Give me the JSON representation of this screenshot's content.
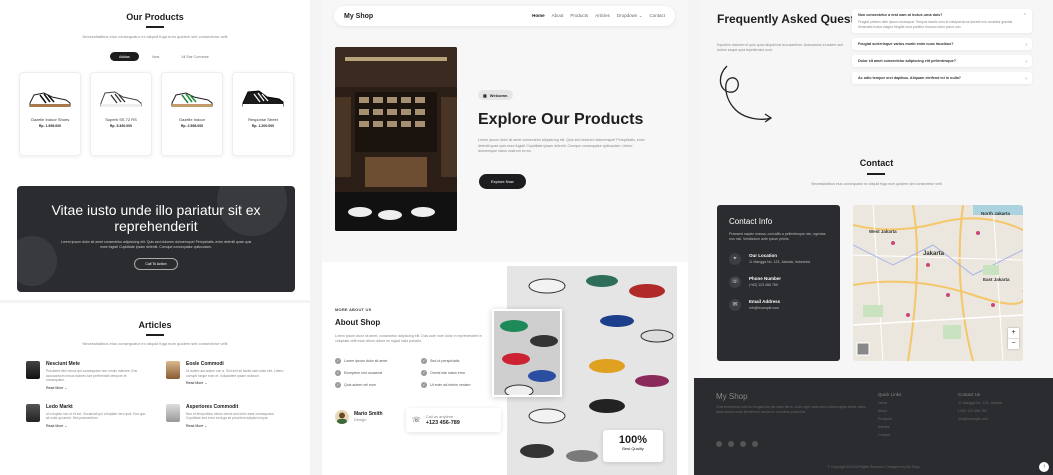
{
  "products": {
    "title": "Our Products",
    "subtitle": "Necessitatibus eius consequatur ex aliquid fuga eum quidem sint consectetur velit",
    "filters": [
      "Adidas",
      "Vans",
      "All Star Converse"
    ],
    "items": [
      {
        "name": "Gazelle Indoor Shoes",
        "price": "Rp. 1.998.000"
      },
      {
        "name": "Superb SS 72 RS",
        "price": "Rp. 5.490.000"
      },
      {
        "name": "Gazelle Indoor",
        "price": "Rp. 2.598.000"
      },
      {
        "name": "Response Street",
        "price": "Rp. 1.200.000"
      }
    ]
  },
  "cta": {
    "title": "Vitae iusto unde illo pariatur sit ex reprehenderit",
    "text": "Lorem ipsum dolor sit amet consectetur adipisicing elit. Quis sed dolorem doloremque! Perspiciatis, enim deleniti quae quis esse fugiat! Cupiditate ipsam deleniti. Cumque consequatur quibusdam.",
    "button": "Call To Action"
  },
  "articles": {
    "title": "Articles",
    "subtitle": "Necessitatibus eius consequatur ex aliquid fuga eum quidem sint consectetur velit",
    "items": [
      {
        "title": "Nesciunt Mete",
        "excerpt": "Provident nihil minus qui consequatur non omnis maiores. Eos accusantium minus dolores iure perferendis tempore et consequatur.",
        "more": "Read More"
      },
      {
        "title": "Eosle Commodi",
        "excerpt": "Ut autem aut autem non a. Sint sint sit facilis nam iusto sint. Libero corrupti neque eum et. Voluptatem ipsam dolorum.",
        "more": "Read More"
      },
      {
        "title": "Ledo Markt",
        "excerpt": "Id voluptas non ut et est. Occaecati qui voluptate vero quis. Eos quo sit nulla qui amet. Sed praesentium.",
        "more": "Read More"
      },
      {
        "title": "Asperiores Commodit",
        "excerpt": "Non et temporibus minus omnis sed dolor esse consequatur. Cupiditate sed error ea fuga sit provident adipisci neque.",
        "more": "Read More"
      }
    ]
  },
  "nav": {
    "brand": "My Shop",
    "links": [
      "Home",
      "About",
      "Products",
      "Articles",
      "Dropdown",
      "Contact"
    ]
  },
  "hero": {
    "badge": "Welcome.",
    "title": "Explore Our Products",
    "desc": "Lorem ipsum dolor sit amet consectetur adipisicing elit. Quis sed dolorem doloremque! Perspiciatis, enim deleniti quae quis esse fugiat! Cupiditate ipsam deleniti. Cumque consequatur quibusdam. Libero doloremque natus nostrum ex ea.",
    "button": "Explore Now"
  },
  "about": {
    "eyebrow": "MORE ABOUT US",
    "title": "About Shop",
    "desc": "Lorem ipsum dolor sit amet, consectetur adipiscing elit. Duis aute irure dolor in reprehenderit in voluptate velit esse cillum dolore eu fugiat nulla pariatur.",
    "features": [
      "Lorem ipsum dolor sit amet",
      "Sed ut perspiciatis",
      "Excepteur sint occaecat",
      "Omnis iste natus error",
      "Quis autem vel eum",
      "Ut enim ad minim veniam"
    ],
    "author_name": "Mario Smith",
    "author_role": "Design",
    "call_label": "Call us anytime",
    "phone": "+123 456-789",
    "stat_value": "100%",
    "stat_label": "Best Quality"
  },
  "faq": {
    "title": "Frequently Asked Questions (FAQ)",
    "desc": "Equidem dolorem et quis quod aliquid est accusantium. Accusamus et autem sed dolore eaque quia repellendus sunt.",
    "items": [
      {
        "q": "Non consectetur a erat nam at lectus urna duis?",
        "a": "Feugiat pretium nibh ipsum consequat. Tempus iaculis urna id volutpat lacus laoreet non curabitur gravida. Venenatis lectus magna fringilla urna porttitor rhoncus dolor purus non."
      },
      {
        "q": "Feugiat scelerisque varius morbi enim nunc faucibus?",
        "a": ""
      },
      {
        "q": "Dolor sit amet consectetur adipiscing elit pellentesque?",
        "a": ""
      },
      {
        "q": "Ac odio tempor orci dapibus. Aliquam eleifend mi in nulla?",
        "a": ""
      }
    ]
  },
  "contact": {
    "title": "Contact",
    "subtitle": "Necessitatibus eius consequatur ex aliquid fuga eum quidem sint consectetur velit",
    "info_title": "Contact Info",
    "info_desc": "Praesent sapien massa, convallis a pellentesque nec, egestas non nisi. Vestibulum ante ipsum primis.",
    "location_label": "Our Location",
    "location_value": "Jl. Mangga No. 123, Jakarta, Indonesia",
    "phone_label": "Phone Number",
    "phone_value": "(+62) 123 456 789",
    "email_label": "Email Address",
    "email_value": "info@example.com",
    "map_labels": [
      "North Jakarta",
      "West Jakarta",
      "Jakarta",
      "East Jakarta"
    ]
  },
  "footer": {
    "brand": "My Shop",
    "desc": "Cras fermentum odio eu feugiat lide par naso tierra. Justo eget nada terra videa magna derita valies darta donna mare fermentum iaculis eu non diam phasellus.",
    "quick_title": "Quick Links",
    "quick_links": [
      "Home",
      "About",
      "Products",
      "Articles",
      "Contact"
    ],
    "contact_title": "Contact Us",
    "contact_items": [
      "Jl. Mangga No. 123, Jakarta",
      "(+62) 123 456 789",
      "info@example.com"
    ],
    "copyright": "© Copyright 2024 All Rights Reserved. Designed by My Shop"
  }
}
